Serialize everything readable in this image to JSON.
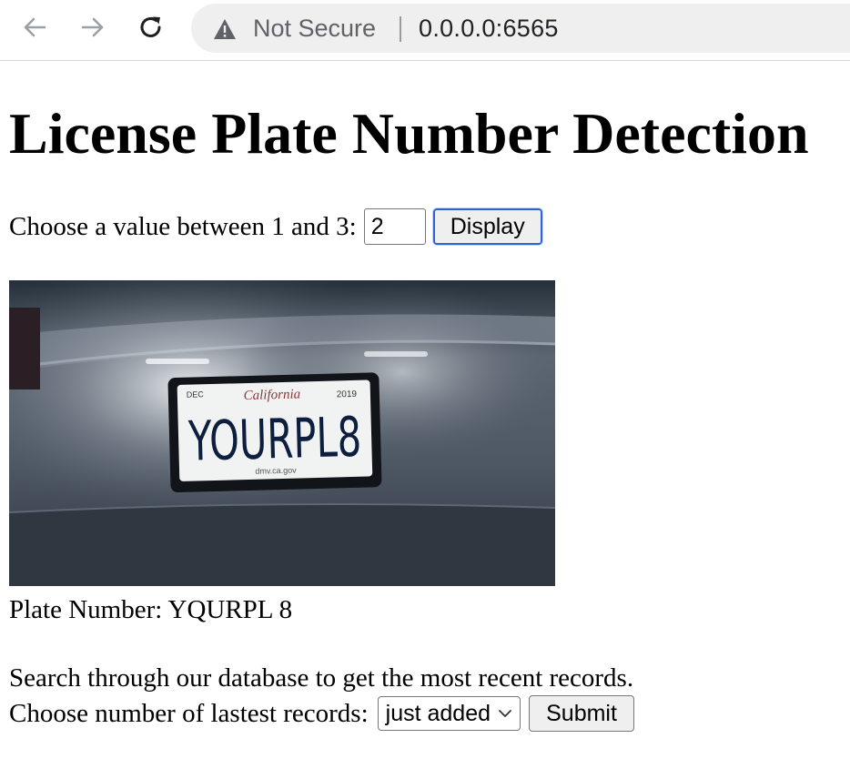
{
  "browser": {
    "security_label": "Not Secure",
    "url": "0.0.0.0:6565"
  },
  "page": {
    "title": "License Plate Number Detection",
    "choose_label": "Choose a value between 1 and 3:",
    "value_input": "2",
    "display_button": "Display",
    "image": {
      "plate_state": "California",
      "plate_month": "DEC",
      "plate_year": "2019",
      "plate_text": "YOURPL8",
      "plate_footer": "dmv.ca.gov"
    },
    "plate_number_text": "Plate Number: YQURPL 8",
    "search_text": "Search through our database to get the most recent records.",
    "records_label": "Choose number of lastest records:",
    "records_select_value": "just added",
    "submit_button": "Submit"
  },
  "icons": {
    "back": "arrow-left-icon",
    "forward": "arrow-right-icon",
    "reload": "reload-icon",
    "warning": "warning-triangle-icon",
    "dropdown": "chevron-down-icon"
  },
  "colors": {
    "focus_ring": "#2a64d6",
    "omnibox_bg": "#efefef",
    "car_body": "#4b5561"
  }
}
